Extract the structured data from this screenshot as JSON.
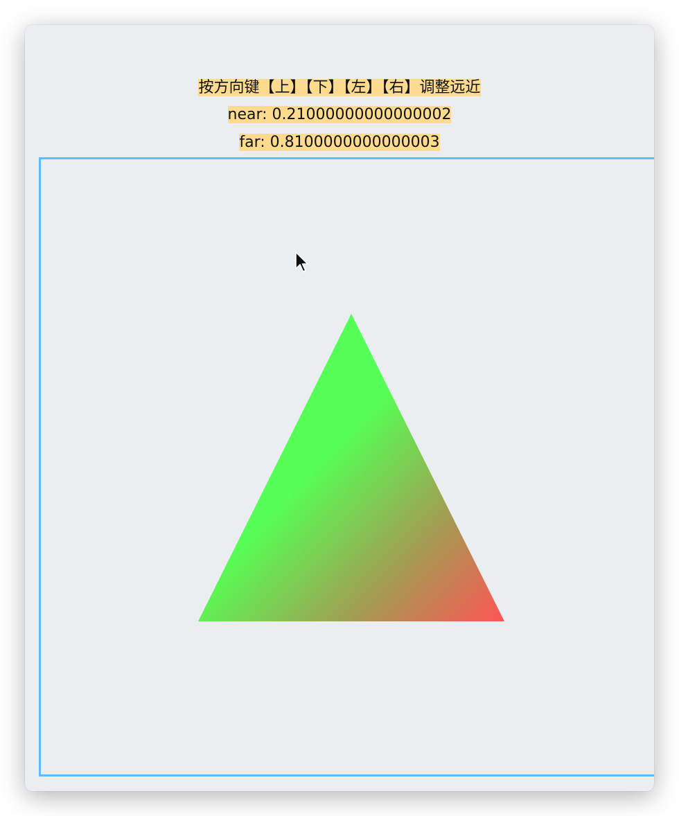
{
  "instructions": "按方向键【上】【下】【左】【右】调整远近",
  "near": {
    "label": "near",
    "value": "0.21000000000000002",
    "text": "near: 0.21000000000000002"
  },
  "far": {
    "label": "far",
    "value": "0.8100000000000003",
    "text": "far: 0.8100000000000003"
  },
  "colors": {
    "background": "#ebeef1",
    "highlight": "#fcdb8f",
    "canvas_border": "#5cbcff",
    "vertex_top": "#55ff55",
    "vertex_bottom_left": "#55ff55",
    "vertex_bottom_right": "#ff5555"
  },
  "icons": {
    "pointer": "mouse-pointer-icon"
  }
}
